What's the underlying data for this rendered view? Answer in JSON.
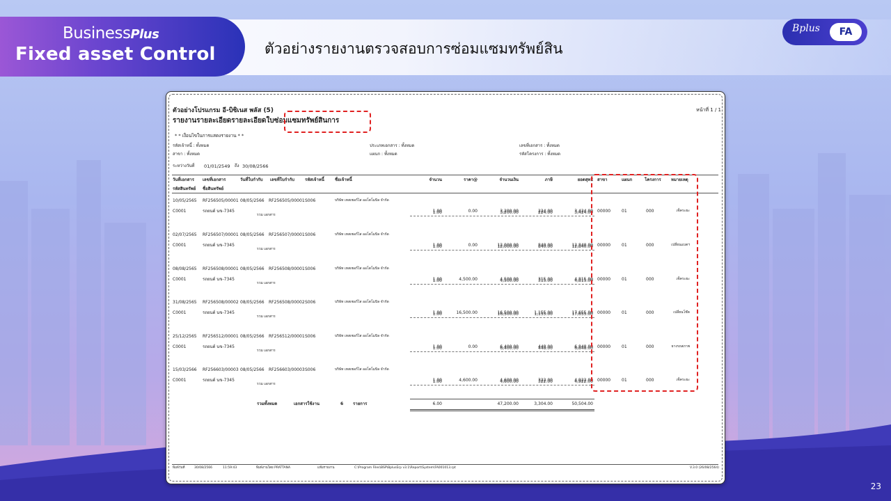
{
  "brand": {
    "line1": "Business",
    "line1_plus": "Plus",
    "line2": "Fixed asset Control"
  },
  "page_title": "ตัวอย่างรายงานตรวจสอบการซ่อมแซมทรัพย์สิน",
  "logo": {
    "bplus": "Bplus",
    "module": "FA"
  },
  "slide_number": "23",
  "colors": {
    "accent": "#2a32b8",
    "brand_purple": "#9b57d6",
    "highlight": "#e02020"
  },
  "report": {
    "company": "ตัวอย่างโปรแกรม อี-บิซิเนส พลัส (5)",
    "page": "หน้าที่ 1 / 1",
    "title": "รายงานรายละเอียดรายละเอียดใบซ่อมแซมทรัพย์สินการ",
    "conditions_header": "* * เงื่อนไขในการแสดงรายงาน * *",
    "filters": [
      "รหัสเจ้าหนี้ : ทั้งหมด",
      "ประเภทเอกสาร : ทั้งหมด",
      "เลขที่เอกสาร : ทั้งหมด",
      "สาขา : ทั้งหมด",
      "แผนก : ทั้งหมด",
      "รหัสโครงการ : ทั้งหมด"
    ],
    "date_range_label": "ระหว่างวันที่",
    "date_from": "01/01/2549",
    "date_to_label": "ถึง",
    "date_to": "30/08/2566",
    "columns_row1": [
      "วันที่เอกสาร",
      "เลขที่เอกสาร",
      "วันที่ใบกำกับ",
      "เลขที่ใบกำกับ",
      "รหัสเจ้าหนี้",
      "ชื่อเจ้าหนี้",
      "จำนวน",
      "ราคา@",
      "จำนวนเงิน",
      "ภาษี",
      "ยอดสุทธิ",
      "สาขา",
      "แผนก",
      "โครงการ",
      "หมายเหตุ"
    ],
    "columns_row2": [
      "รหัสสินทรัพย์",
      "ชื่อสินทรัพย์"
    ],
    "subtotal_label": "รวม เอกสาร",
    "records": [
      {
        "doc_date": "10/05/2565",
        "doc_no": "RF256505/00001",
        "inv_date": "08/05/2566",
        "inv_no": "RF256505/00001",
        "vendor_code": "S006",
        "vendor_name": "บริษัท เทสเซอร์ไส ออโตโมบิล จำกัด",
        "asset_code": "C0001",
        "asset_name": "รถยนต์ นข-7345",
        "qty": "1.00",
        "price": "0.00",
        "amount": "3,200.00",
        "vat": "224.00",
        "net": "3,424.00",
        "branch": "00000",
        "dept": "01",
        "project": "000",
        "remark": "เช็คระยะ",
        "sub_qty": "1.00",
        "sub_amount": "3,200.00",
        "sub_vat": "224.00",
        "sub_net": "3,424.00"
      },
      {
        "doc_date": "02/07/2565",
        "doc_no": "RF256507/00001",
        "inv_date": "08/05/2566",
        "inv_no": "RF256507/00001",
        "vendor_code": "S006",
        "vendor_name": "บริษัท เทสเซอร์ไส ออโตโมบิล จำกัด",
        "asset_code": "C0001",
        "asset_name": "รถยนต์ นข-7345",
        "qty": "1.00",
        "price": "0.00",
        "amount": "12,000.00",
        "vat": "840.00",
        "net": "12,840.00",
        "branch": "00000",
        "dept": "01",
        "project": "000",
        "remark": "เปลี่ยนแบตฯ",
        "sub_qty": "1.00",
        "sub_amount": "12,000.00",
        "sub_vat": "840.00",
        "sub_net": "12,840.00"
      },
      {
        "doc_date": "08/08/2565",
        "doc_no": "RF256508/00001",
        "inv_date": "08/05/2566",
        "inv_no": "RF256508/00001",
        "vendor_code": "S006",
        "vendor_name": "บริษัท เทสเซอร์ไส ออโตโมบิล จำกัด",
        "asset_code": "C0001",
        "asset_name": "รถยนต์ นข-7345",
        "qty": "1.00",
        "price": "4,500.00",
        "amount": "4,500.00",
        "vat": "315.00",
        "net": "4,815.00",
        "branch": "00000",
        "dept": "01",
        "project": "000",
        "remark": "เช็คระยะ",
        "sub_qty": "1.00",
        "sub_amount": "4,500.00",
        "sub_vat": "315.00",
        "sub_net": "4,815.00"
      },
      {
        "doc_date": "31/08/2565",
        "doc_no": "RF256508/00002",
        "inv_date": "08/05/2566",
        "inv_no": "RF256508/00002",
        "vendor_code": "S006",
        "vendor_name": "บริษัท เทสเซอร์ไส ออโตโมบิล จำกัด",
        "asset_code": "C0001",
        "asset_name": "รถยนต์ นข-7345",
        "qty": "1.00",
        "price": "16,500.00",
        "amount": "16,500.00",
        "vat": "1,155.00",
        "net": "17,655.00",
        "branch": "00000",
        "dept": "01",
        "project": "000",
        "remark": "เปลี่ยนโช๊ค",
        "sub_qty": "1.00",
        "sub_amount": "16,500.00",
        "sub_vat": "1,155.00",
        "sub_net": "17,655.00"
      },
      {
        "doc_date": "25/12/2565",
        "doc_no": "RF256512/00001",
        "inv_date": "08/05/2566",
        "inv_no": "RF256512/00001",
        "vendor_code": "S006",
        "vendor_name": "บริษัท เทสเซอร์ไส ออโตโมบิล จำกัด",
        "asset_code": "C0001",
        "asset_name": "รถยนต์ นข-7345",
        "qty": "1.00",
        "price": "0.00",
        "amount": "6,400.00",
        "vat": "448.00",
        "net": "6,848.00",
        "branch": "00000",
        "dept": "01",
        "project": "000",
        "remark": "ยางรถสภาพ",
        "sub_qty": "1.00",
        "sub_amount": "6,400.00",
        "sub_vat": "448.00",
        "sub_net": "6,848.00"
      },
      {
        "doc_date": "15/03/2566",
        "doc_no": "RF256603/00003",
        "inv_date": "08/05/2566",
        "inv_no": "RF256603/00003",
        "vendor_code": "S006",
        "vendor_name": "บริษัท เทสเซอร์ไส ออโตโมบิล จำกัด",
        "asset_code": "C0001",
        "asset_name": "รถยนต์ นข-7345",
        "qty": "1.00",
        "price": "4,600.00",
        "amount": "4,600.00",
        "vat": "322.00",
        "net": "4,922.00",
        "branch": "00000",
        "dept": "01",
        "project": "000",
        "remark": "เช็คระยะ",
        "sub_qty": "1.00",
        "sub_amount": "4,600.00",
        "sub_vat": "322.00",
        "sub_net": "4,922.00"
      }
    ],
    "total": {
      "label": "รวมทั้งหมด",
      "docs_label": "เอกสารใช้งาน",
      "docs_count": "6",
      "items_label": "รายการ",
      "qty": "6.00",
      "amount": "47,200.00",
      "vat": "3,304.00",
      "net": "50,504.00"
    },
    "footer": {
      "print_date_label": "พิมพ์วันที่",
      "print_date": "30/08/2566",
      "print_time": "11:59:43",
      "printed_by": "พิมพ์งานโดย PRATTANA",
      "file_label": "แฟ้มรายงาน",
      "path": "C:\\Program Files\\BSP\\BplusErp v3.1\\Report\\System\\FA001013.rpt",
      "version": "V.3.0 (26/08/2564)"
    }
  }
}
